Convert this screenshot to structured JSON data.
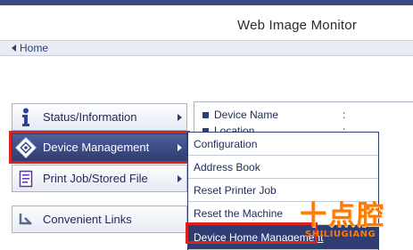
{
  "app": {
    "title": "Web Image Monitor"
  },
  "nav": {
    "home_label": "Home"
  },
  "menu": {
    "items": [
      {
        "label": "Status/Information",
        "icon": "info-icon"
      },
      {
        "label": "Device Management",
        "icon": "device-management-icon",
        "active": true
      },
      {
        "label": "Print Job/Stored File",
        "icon": "document-icon"
      },
      {
        "label": "Convenient Links",
        "icon": "link-arrow-icon"
      }
    ]
  },
  "info": {
    "rows": [
      {
        "label": "Device Name",
        "value": ":"
      },
      {
        "label": "Location",
        "value": ":"
      }
    ]
  },
  "submenu": {
    "items": [
      {
        "label": "Configuration"
      },
      {
        "label": "Address Book"
      },
      {
        "label": "Reset Printer Job"
      },
      {
        "label": "Reset the Machine"
      },
      {
        "label": "Device Home Management",
        "highlighted": true
      }
    ]
  },
  "watermark": {
    "text_cn": "十点腔",
    "text_en": "SHILIUGIANG"
  },
  "colors": {
    "accent": "#2f3d72",
    "highlight_box": "#e0201b",
    "watermark": "#ff7a00"
  }
}
